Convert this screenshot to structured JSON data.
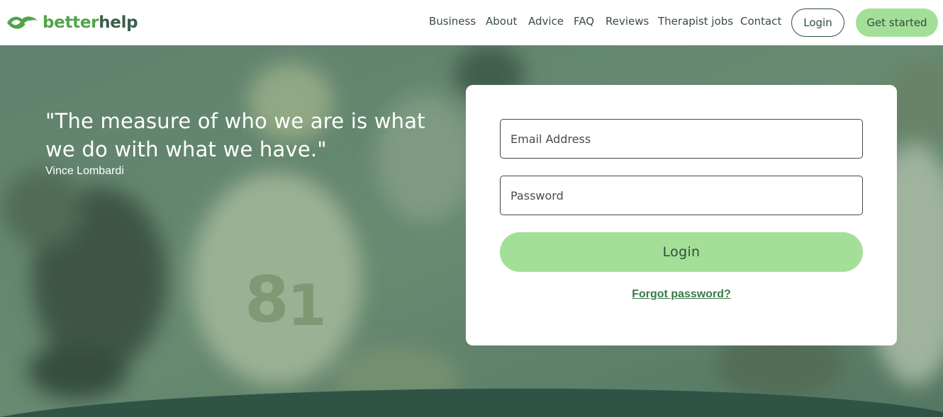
{
  "brand": {
    "name_part1": "better",
    "name_part2": "help",
    "logo_icon": "leaf-logo-icon",
    "colors": {
      "green": "#52a44a",
      "dark": "#3b5e4d",
      "accent": "#a4df98",
      "link": "#3a7a49"
    }
  },
  "nav": {
    "links": [
      "Business",
      "About",
      "Advice",
      "FAQ",
      "Reviews",
      "Therapist jobs",
      "Contact"
    ],
    "login_label": "Login",
    "get_started_label": "Get started"
  },
  "hero": {
    "quote": "\"The measure of who we are is what we do with what we have.\"",
    "author": "Vince Lombardi"
  },
  "login_form": {
    "email_placeholder": "Email Address",
    "password_placeholder": "Password",
    "submit_label": "Login",
    "forgot_label": "Forgot password?"
  }
}
